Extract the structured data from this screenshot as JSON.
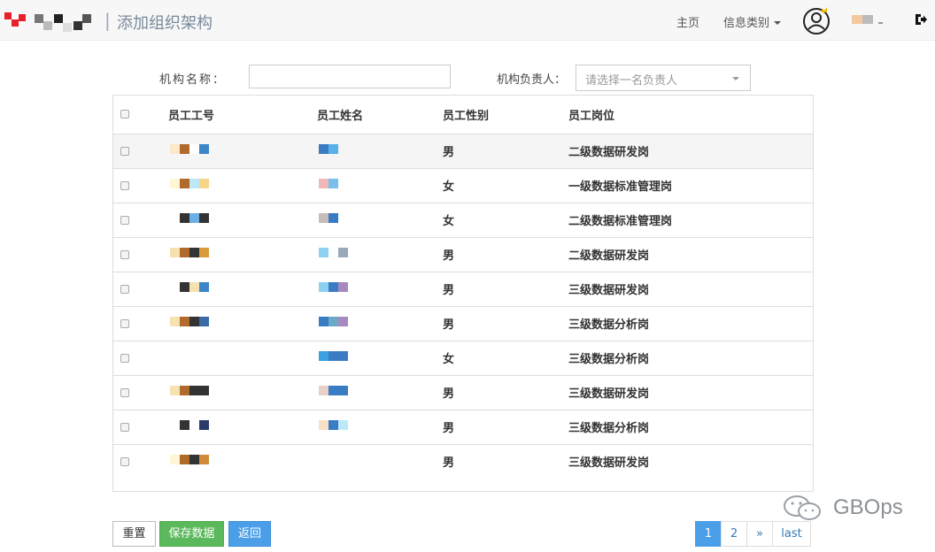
{
  "header": {
    "separator": "|",
    "title": "添加组织架构",
    "nav_home": "主页",
    "nav_category": "信息类别"
  },
  "form": {
    "org_name_label": "机构名称：",
    "org_name_value": "",
    "leader_label": "机构负责人：",
    "leader_placeholder": "请选择一名负责人"
  },
  "table": {
    "headers": [
      "员工工号",
      "员工姓名",
      "员工性别",
      "员工岗位"
    ],
    "rows": [
      {
        "gender": "男",
        "position": "二级数据研发岗"
      },
      {
        "gender": "女",
        "position": "一级数据标准管理岗"
      },
      {
        "gender": "女",
        "position": "二级数据标准管理岗"
      },
      {
        "gender": "男",
        "position": "二级数据研发岗"
      },
      {
        "gender": "男",
        "position": "三级数据研发岗"
      },
      {
        "gender": "男",
        "position": "三级数据分析岗"
      },
      {
        "gender": "女",
        "position": "三级数据分析岗"
      },
      {
        "gender": "男",
        "position": "三级数据研发岗"
      },
      {
        "gender": "男",
        "position": "三级数据分析岗"
      },
      {
        "gender": "男",
        "position": "三级数据研发岗"
      }
    ]
  },
  "buttons": {
    "reset": "重置",
    "save": "保存数据",
    "back": "返回"
  },
  "pagination": {
    "page1": "1",
    "page2": "2",
    "next": "»",
    "last": "last",
    "active_page": 1
  },
  "watermark": "GBOps",
  "colors": {
    "save_green": "#5cb85c",
    "primary_blue": "#4a9fe8",
    "logo_red": "#e8202a"
  },
  "icons": [
    "logo-icon",
    "caret-down-icon",
    "avatar-icon",
    "logout-icon",
    "checkbox-icon",
    "wechat-icon"
  ]
}
